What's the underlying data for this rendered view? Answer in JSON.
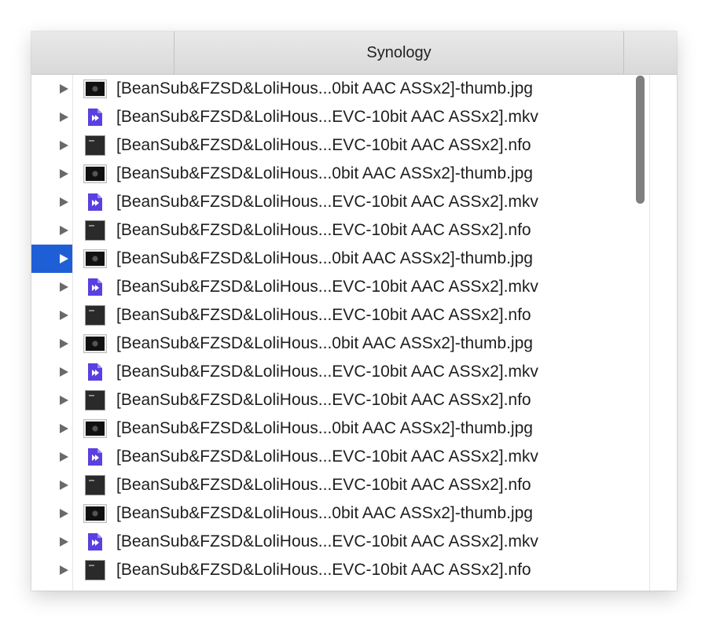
{
  "header": {
    "column_title": "Synology"
  },
  "colors": {
    "selection": "#1f5fd6",
    "mkv_icon": "#5b3fe0",
    "header_bg": "#dedede"
  },
  "files": [
    {
      "name": "[BeanSub&FZSD&LoliHous...0bit AAC ASSx2]-thumb.jpg",
      "type": "jpg",
      "icon": "image-thumbnail-icon"
    },
    {
      "name": "[BeanSub&FZSD&LoliHous...EVC-10bit AAC ASSx2].mkv",
      "type": "mkv",
      "icon": "video-file-icon"
    },
    {
      "name": "[BeanSub&FZSD&LoliHous...EVC-10bit AAC ASSx2].nfo",
      "type": "nfo",
      "icon": "nfo-file-icon"
    },
    {
      "name": "[BeanSub&FZSD&LoliHous...0bit AAC ASSx2]-thumb.jpg",
      "type": "jpg",
      "icon": "image-thumbnail-icon"
    },
    {
      "name": "[BeanSub&FZSD&LoliHous...EVC-10bit AAC ASSx2].mkv",
      "type": "mkv",
      "icon": "video-file-icon"
    },
    {
      "name": "[BeanSub&FZSD&LoliHous...EVC-10bit AAC ASSx2].nfo",
      "type": "nfo",
      "icon": "nfo-file-icon"
    },
    {
      "name": "[BeanSub&FZSD&LoliHous...0bit AAC ASSx2]-thumb.jpg",
      "type": "jpg",
      "icon": "image-thumbnail-icon",
      "selected": true
    },
    {
      "name": "[BeanSub&FZSD&LoliHous...EVC-10bit AAC ASSx2].mkv",
      "type": "mkv",
      "icon": "video-file-icon"
    },
    {
      "name": "[BeanSub&FZSD&LoliHous...EVC-10bit AAC ASSx2].nfo",
      "type": "nfo",
      "icon": "nfo-file-icon"
    },
    {
      "name": "[BeanSub&FZSD&LoliHous...0bit AAC ASSx2]-thumb.jpg",
      "type": "jpg",
      "icon": "image-thumbnail-icon"
    },
    {
      "name": "[BeanSub&FZSD&LoliHous...EVC-10bit AAC ASSx2].mkv",
      "type": "mkv",
      "icon": "video-file-icon"
    },
    {
      "name": "[BeanSub&FZSD&LoliHous...EVC-10bit AAC ASSx2].nfo",
      "type": "nfo",
      "icon": "nfo-file-icon"
    },
    {
      "name": "[BeanSub&FZSD&LoliHous...0bit AAC ASSx2]-thumb.jpg",
      "type": "jpg",
      "icon": "image-thumbnail-icon"
    },
    {
      "name": "[BeanSub&FZSD&LoliHous...EVC-10bit AAC ASSx2].mkv",
      "type": "mkv",
      "icon": "video-file-icon"
    },
    {
      "name": "[BeanSub&FZSD&LoliHous...EVC-10bit AAC ASSx2].nfo",
      "type": "nfo",
      "icon": "nfo-file-icon"
    },
    {
      "name": "[BeanSub&FZSD&LoliHous...0bit AAC ASSx2]-thumb.jpg",
      "type": "jpg",
      "icon": "image-thumbnail-icon"
    },
    {
      "name": "[BeanSub&FZSD&LoliHous...EVC-10bit AAC ASSx2].mkv",
      "type": "mkv",
      "icon": "video-file-icon"
    },
    {
      "name": "[BeanSub&FZSD&LoliHous...EVC-10bit AAC ASSx2].nfo",
      "type": "nfo",
      "icon": "nfo-file-icon"
    }
  ]
}
